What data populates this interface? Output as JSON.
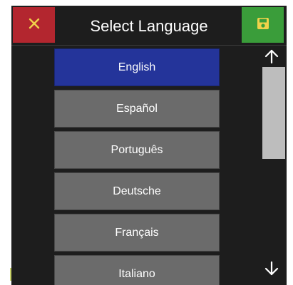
{
  "header": {
    "title": "Select Language"
  },
  "icons": {
    "close": "close-icon",
    "save": "save-icon",
    "scroll_up": "arrow-up-icon",
    "scroll_down": "arrow-down-icon"
  },
  "colors": {
    "close_button": "#b3262f",
    "save_button": "#3a9d3a",
    "selected_item": "#24349a",
    "item": "#6b6b6b",
    "background": "#1d1d1d"
  },
  "languages": [
    {
      "label": "English",
      "selected": true
    },
    {
      "label": "Español",
      "selected": false
    },
    {
      "label": "Português",
      "selected": false
    },
    {
      "label": "Deutsche",
      "selected": false
    },
    {
      "label": "Français",
      "selected": false
    },
    {
      "label": "Italiano",
      "selected": false
    }
  ],
  "scrollbar": {
    "position_fraction": 0.0,
    "visible_fraction": 0.48
  }
}
